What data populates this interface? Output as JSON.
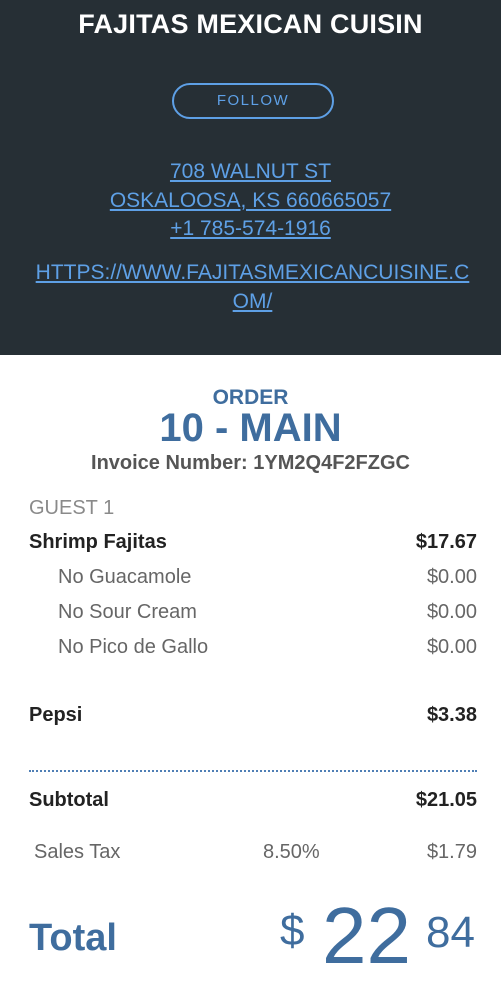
{
  "header": {
    "name": "FAJITAS MEXICAN CUISIN",
    "follow_label": "FOLLOW",
    "address_line1": "708 WALNUT ST",
    "address_line2": "OSKALOOSA, KS 660665057",
    "phone": "+1 785-574-1916",
    "website": "HTTPS://WWW.FAJITASMEXICANCUISINE.COM/"
  },
  "order": {
    "label": "ORDER",
    "number": "10 - MAIN",
    "invoice": "Invoice Number: 1YM2Q4F2FZGC"
  },
  "guest_label": "GUEST 1",
  "items": [
    {
      "name": "Shrimp Fajitas",
      "price": "$17.67"
    },
    {
      "name": "No Guacamole",
      "price": "$0.00"
    },
    {
      "name": "No Sour Cream",
      "price": "$0.00"
    },
    {
      "name": "No Pico de Gallo",
      "price": "$0.00"
    },
    {
      "name": "Pepsi",
      "price": "$3.38"
    }
  ],
  "subtotal": {
    "label": "Subtotal",
    "value": "$21.05"
  },
  "tax": {
    "label": "Sales Tax",
    "rate": "8.50%",
    "value": "$1.79"
  },
  "total": {
    "label": "Total",
    "currency": "$",
    "whole": "22",
    "cents": "84"
  },
  "colors": {
    "header_bg": "#262f35",
    "link": "#5ea0e6",
    "accent": "#3f6d9e"
  }
}
